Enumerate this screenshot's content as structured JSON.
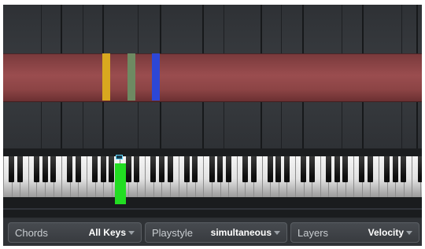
{
  "chord_bars": [
    {
      "name": "chord-bar-yellow",
      "color": "#d9a81f"
    },
    {
      "name": "chord-bar-green",
      "color": "#6e8a62"
    },
    {
      "name": "chord-bar-blue",
      "color": "#2d47d6"
    }
  ],
  "keyboard": {
    "pressed_key_color": "#22dd22",
    "marker_color": "#5fd6ff"
  },
  "controls": {
    "chords": {
      "label": "Chords",
      "value": "All Keys",
      "icon": "dropdown-arrow-icon"
    },
    "playstyle": {
      "label": "Playstyle",
      "value": "simultaneous",
      "icon": "dropdown-arrow-icon"
    },
    "layers": {
      "label": "Layers",
      "value": "Velocity",
      "icon": "dropdown-arrow-icon"
    }
  },
  "colors": {
    "band": "#9a4d4f",
    "background": "#2d3033"
  }
}
